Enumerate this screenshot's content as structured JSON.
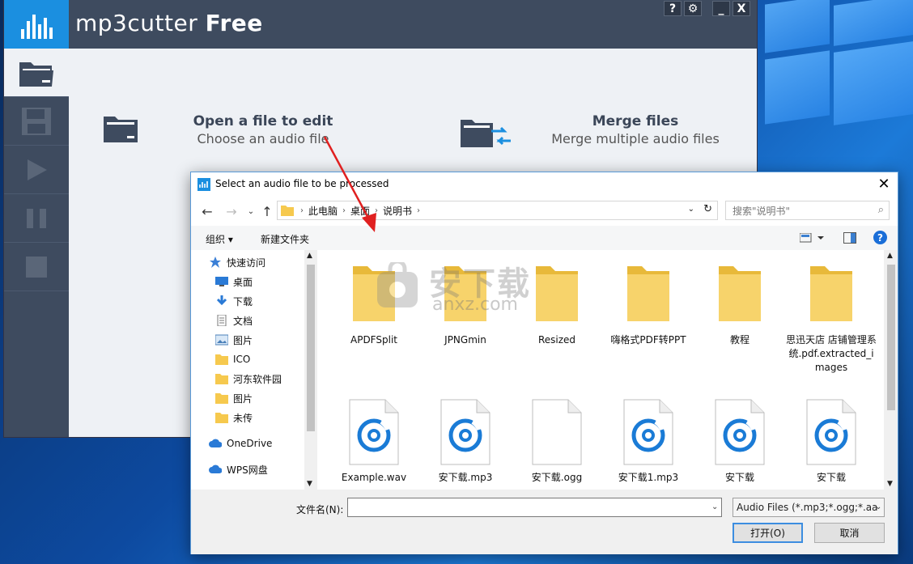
{
  "app": {
    "title_light": "mp3cutter",
    "title_bold": "Free",
    "titlebar_buttons": [
      "?",
      "⚙",
      "_",
      "X"
    ],
    "open_title": "Open a file to edit",
    "open_sub": "Choose an audio file",
    "merge_title": "Merge files",
    "merge_sub": "Merge multiple audio files",
    "colors": {
      "titlebar": "#3e4b5f",
      "logo": "#1b8fe0",
      "main_bg": "#eef1f5"
    }
  },
  "dialog": {
    "title": "Select an audio file to be processed",
    "close": "✕",
    "breadcrumb": [
      "此电脑",
      "桌面",
      "说明书"
    ],
    "search_placeholder": "搜索\"说明书\"",
    "organize": "组织 ▾",
    "new_folder": "新建文件夹",
    "help": "?",
    "nav": [
      {
        "label": "快速访问",
        "icon": "star-icon"
      },
      {
        "label": "桌面",
        "icon": "desktop-icon",
        "pinned": true
      },
      {
        "label": "下载",
        "icon": "download-icon",
        "pinned": true
      },
      {
        "label": "文档",
        "icon": "document-icon",
        "pinned": true
      },
      {
        "label": "图片",
        "icon": "pictures-icon",
        "pinned": true
      },
      {
        "label": "ICO",
        "icon": "folder-icon"
      },
      {
        "label": "河东软件园",
        "icon": "folder-icon"
      },
      {
        "label": "图片",
        "icon": "folder-icon"
      },
      {
        "label": "未传",
        "icon": "folder-icon"
      },
      {
        "label": "OneDrive",
        "icon": "cloud-icon"
      },
      {
        "label": "WPS网盘",
        "icon": "cloud-icon"
      }
    ],
    "files": [
      {
        "name": "APDFSplit",
        "type": "folder"
      },
      {
        "name": "JPNGmin",
        "type": "folder"
      },
      {
        "name": "Resized",
        "type": "folder"
      },
      {
        "name": "嗨格式PDF转PPT",
        "type": "folder"
      },
      {
        "name": "教程",
        "type": "folder"
      },
      {
        "name": "思迅天店 店铺管理系统.pdf.extracted_images",
        "type": "folder"
      },
      {
        "name": "Example.wav",
        "type": "audio"
      },
      {
        "name": "安下载.mp3",
        "type": "audio"
      },
      {
        "name": "安下载.ogg",
        "type": "blank"
      },
      {
        "name": "安下载1.mp3",
        "type": "audio"
      },
      {
        "name": "安下载",
        "type": "audio"
      },
      {
        "name": "安下载",
        "type": "audio"
      }
    ],
    "filename_label": "文件名(N):",
    "filename_value": "",
    "filetype": "Audio Files (*.mp3;*.ogg;*.aa",
    "open_btn": "打开(O)",
    "cancel_btn": "取消"
  },
  "watermark": {
    "text_cn": "安下载",
    "text_en": "anxz.com"
  }
}
